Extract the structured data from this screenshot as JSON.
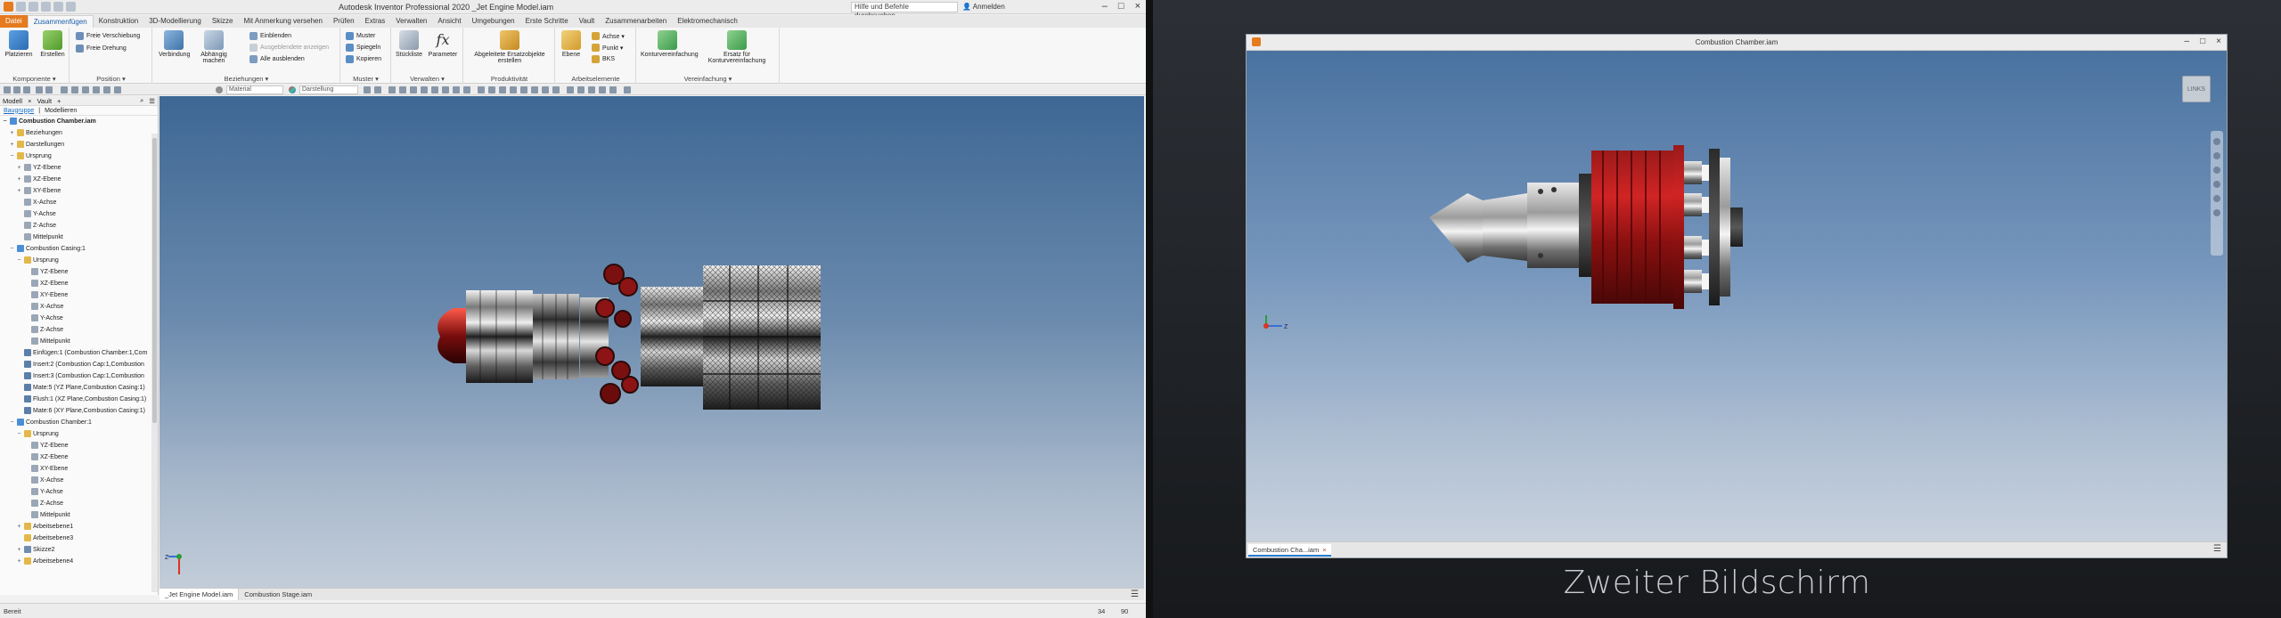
{
  "app": {
    "title": "Autodesk Inventor Professional 2020   _Jet Engine Model.iam",
    "help_search": "Hilfe und Befehle durchsuchen...",
    "signin": "Anmelden"
  },
  "ribbon_tabs": [
    "Datei",
    "Zusammenfügen",
    "Konstruktion",
    "3D-Modellierung",
    "Skizze",
    "Mit Anmerkung versehen",
    "Prüfen",
    "Extras",
    "Verwalten",
    "Ansicht",
    "Umgebungen",
    "Erste Schritte",
    "Vault",
    "Zusammenarbeiten",
    "Elektromechanisch"
  ],
  "panels": {
    "komponente": {
      "label": "Komponente ▾",
      "platzieren": "Platzieren",
      "erstellen": "Erstellen"
    },
    "position": {
      "label": "Position ▾",
      "freie_verschiebung": "Freie Verschiebung",
      "freie_drehung": "Freie Drehung"
    },
    "beziehungen": {
      "label": "Beziehungen ▾",
      "verbindung": "Verbindung",
      "abhaengig": "Abhängig machen",
      "einblenden": "Einblenden",
      "ausgeblendet": "Ausgeblendete anzeigen",
      "alle_ausblenden": "Alle ausblenden"
    },
    "muster": {
      "label": "Muster ▾",
      "muster": "Muster",
      "spiegeln": "Spiegeln",
      "kopieren": "Kopieren"
    },
    "verwalten": {
      "label": "Verwalten ▾",
      "stueckliste": "Stückliste",
      "parameter": "Parameter"
    },
    "produktivitaet": {
      "label": "Produktivität",
      "abgeleitete": "Abgeleitete Ersatzobjekte erstellen"
    },
    "arbeitselemente": {
      "label": "Arbeitselemente",
      "ebene": "Ebene",
      "achse": "Achse ▾",
      "punkt": "Punkt ▾",
      "bks": "BKS"
    },
    "vereinfachung": {
      "label": "Vereinfachung ▾",
      "konturvereinfachung": "Konturvereinfachung",
      "ersatz": "Ersatz für Konturvereinfachung"
    }
  },
  "toolbar": {
    "material": "Material",
    "darstellung": "Darstellung"
  },
  "browser": {
    "tabs": [
      "Modell",
      "Vault"
    ],
    "sub": [
      "Baugruppe",
      "Modellieren"
    ],
    "items": [
      {
        "label": "Combustion Chamber.iam",
        "level": 0,
        "exp": "−",
        "icon": "#4a8fd6",
        "bold": true
      },
      {
        "label": "Beziehungen",
        "level": 1,
        "exp": "+",
        "icon": "#e3b84a"
      },
      {
        "label": "Darstellungen",
        "level": 1,
        "exp": "+",
        "icon": "#e3b84a"
      },
      {
        "label": "Ursprung",
        "level": 1,
        "exp": "−",
        "icon": "#e3b84a"
      },
      {
        "label": "YZ-Ebene",
        "level": 2,
        "exp": "+",
        "icon": "#9aa7b6"
      },
      {
        "label": "XZ-Ebene",
        "level": 2,
        "exp": "+",
        "icon": "#9aa7b6"
      },
      {
        "label": "XY-Ebene",
        "level": 2,
        "exp": "+",
        "icon": "#9aa7b6"
      },
      {
        "label": "X-Achse",
        "level": 2,
        "exp": "",
        "icon": "#9aa7b6"
      },
      {
        "label": "Y-Achse",
        "level": 2,
        "exp": "",
        "icon": "#9aa7b6"
      },
      {
        "label": "Z-Achse",
        "level": 2,
        "exp": "",
        "icon": "#9aa7b6"
      },
      {
        "label": "Mittelpunkt",
        "level": 2,
        "exp": "",
        "icon": "#9aa7b6"
      },
      {
        "label": "Combustion Casing:1",
        "level": 1,
        "exp": "−",
        "icon": "#4a8fd6"
      },
      {
        "label": "Ursprung",
        "level": 2,
        "exp": "−",
        "icon": "#e3b84a"
      },
      {
        "label": "YZ-Ebene",
        "level": 3,
        "exp": "",
        "icon": "#9aa7b6"
      },
      {
        "label": "XZ-Ebene",
        "level": 3,
        "exp": "",
        "icon": "#9aa7b6"
      },
      {
        "label": "XY-Ebene",
        "level": 3,
        "exp": "",
        "icon": "#9aa7b6"
      },
      {
        "label": "X-Achse",
        "level": 3,
        "exp": "",
        "icon": "#9aa7b6"
      },
      {
        "label": "Y-Achse",
        "level": 3,
        "exp": "",
        "icon": "#9aa7b6"
      },
      {
        "label": "Z-Achse",
        "level": 3,
        "exp": "",
        "icon": "#9aa7b6"
      },
      {
        "label": "Mittelpunkt",
        "level": 3,
        "exp": "",
        "icon": "#9aa7b6"
      },
      {
        "label": "Einfügen:1 (Combustion Chamber:1,Com",
        "level": 2,
        "exp": "",
        "icon": "#5b7fa8"
      },
      {
        "label": "Insert:2 (Combustion Cap:1,Combustion",
        "level": 2,
        "exp": "",
        "icon": "#5b7fa8"
      },
      {
        "label": "Insert:3 (Combustion Cap:1,Combustion",
        "level": 2,
        "exp": "",
        "icon": "#5b7fa8"
      },
      {
        "label": "Mate:5 (YZ Plane,Combustion Casing:1)",
        "level": 2,
        "exp": "",
        "icon": "#5b7fa8"
      },
      {
        "label": "Flush:1 (XZ Plane,Combustion Casing:1)",
        "level": 2,
        "exp": "",
        "icon": "#5b7fa8"
      },
      {
        "label": "Mate:6 (XY Plane,Combustion Casing:1)",
        "level": 2,
        "exp": "",
        "icon": "#5b7fa8"
      },
      {
        "label": "Combustion Chamber:1",
        "level": 1,
        "exp": "−",
        "icon": "#4a8fd6"
      },
      {
        "label": "Ursprung",
        "level": 2,
        "exp": "−",
        "icon": "#e3b84a"
      },
      {
        "label": "YZ-Ebene",
        "level": 3,
        "exp": "",
        "icon": "#9aa7b6"
      },
      {
        "label": "XZ-Ebene",
        "level": 3,
        "exp": "",
        "icon": "#9aa7b6"
      },
      {
        "label": "XY-Ebene",
        "level": 3,
        "exp": "",
        "icon": "#9aa7b6"
      },
      {
        "label": "X-Achse",
        "level": 3,
        "exp": "",
        "icon": "#9aa7b6"
      },
      {
        "label": "Y-Achse",
        "level": 3,
        "exp": "",
        "icon": "#9aa7b6"
      },
      {
        "label": "Z-Achse",
        "level": 3,
        "exp": "",
        "icon": "#9aa7b6"
      },
      {
        "label": "Mittelpunkt",
        "level": 3,
        "exp": "",
        "icon": "#9aa7b6"
      },
      {
        "label": "Arbeitsebene1",
        "level": 2,
        "exp": "+",
        "icon": "#e3b84a"
      },
      {
        "label": "Arbeitsebene3",
        "level": 2,
        "exp": "",
        "icon": "#e3b84a"
      },
      {
        "label": "Skizze2",
        "level": 2,
        "exp": "+",
        "icon": "#6f8db0"
      },
      {
        "label": "Arbeitsebene4",
        "level": 2,
        "exp": "+",
        "icon": "#e3b84a"
      }
    ]
  },
  "doc_tabs": [
    "_Jet Engine Model.iam",
    "Combustion Stage.iam"
  ],
  "status": {
    "text": "Bereit",
    "n1": "34",
    "n2": "90"
  },
  "second_window": {
    "title": "Combustion Chamber.iam",
    "tab": "Combustion Cha...iam",
    "viewcube": "LINKS"
  },
  "caption": "Zweiter Bildschirm"
}
